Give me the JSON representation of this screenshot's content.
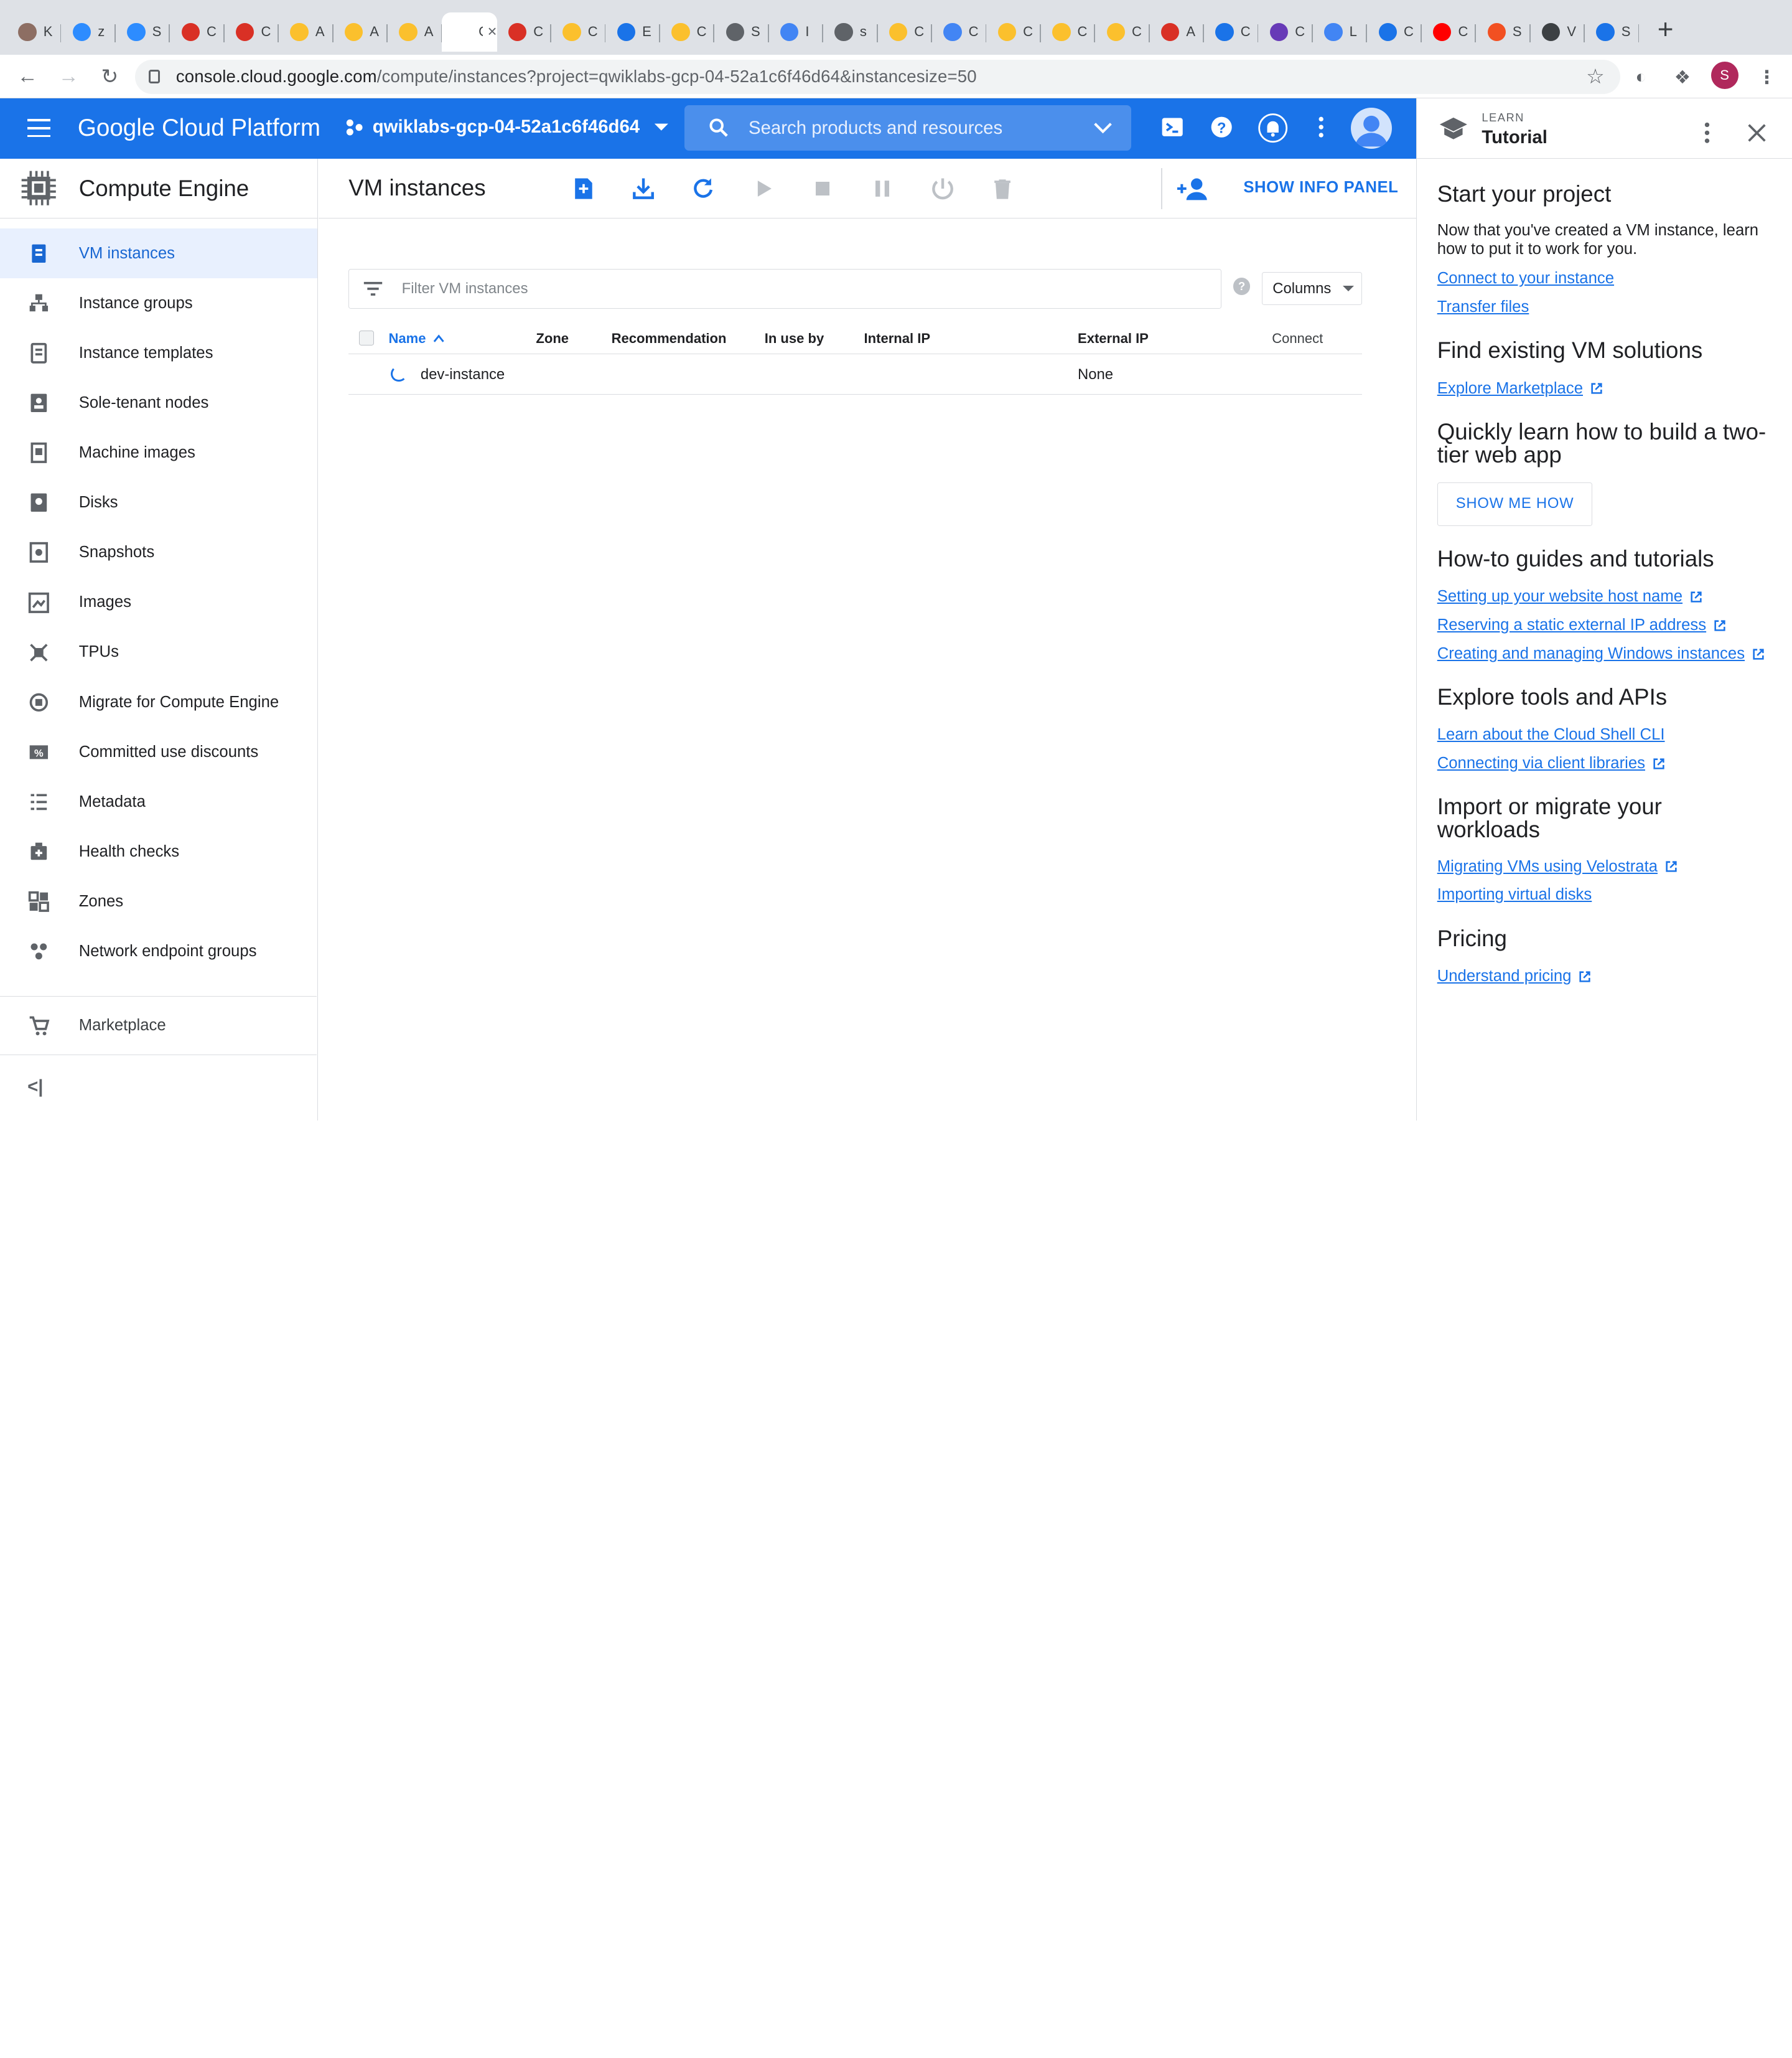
{
  "browser": {
    "tabs": [
      {
        "short": "K",
        "color": "#8d6e63"
      },
      {
        "short": "z",
        "color": "#2d8cff"
      },
      {
        "short": "S",
        "color": "#2d8cff"
      },
      {
        "short": "C",
        "color": "#d93025"
      },
      {
        "short": "C",
        "color": "#d93025"
      },
      {
        "short": "A",
        "color": "#fbc02d"
      },
      {
        "short": "A",
        "color": "#fbc02d"
      },
      {
        "short": "A",
        "color": "#fbc02d"
      },
      {
        "short": "G",
        "color": "#ffffff",
        "active": true
      },
      {
        "short": "C",
        "color": "#d93025"
      },
      {
        "short": "C",
        "color": "#fbc02d"
      },
      {
        "short": "E",
        "color": "#1a73e8"
      },
      {
        "short": "C",
        "color": "#fbc02d"
      },
      {
        "short": "S",
        "color": "#5f6368"
      },
      {
        "short": "I",
        "color": "#4285f4"
      },
      {
        "short": "s",
        "color": "#5f6368"
      },
      {
        "short": "C",
        "color": "#fbc02d"
      },
      {
        "short": "C",
        "color": "#4285f4"
      },
      {
        "short": "C",
        "color": "#fbc02d"
      },
      {
        "short": "C",
        "color": "#fbc02d"
      },
      {
        "short": "C",
        "color": "#fbc02d"
      },
      {
        "short": "A",
        "color": "#d93025"
      },
      {
        "short": "C",
        "color": "#1a73e8"
      },
      {
        "short": "C",
        "color": "#673ab7"
      },
      {
        "short": "L",
        "color": "#4285f4"
      },
      {
        "short": "C",
        "color": "#1a73e8"
      },
      {
        "short": "C",
        "color": "#ff0000"
      },
      {
        "short": "S",
        "color": "#f25022"
      },
      {
        "short": "V",
        "color": "#3c4043"
      },
      {
        "short": "S",
        "color": "#1a73e8"
      }
    ],
    "active_tab_title": "G",
    "url_host": "console.cloud.google.com",
    "url_path": "/compute/instances?project=qwiklabs-gcp-04-52a1c6f46d64&instancesize=50",
    "profile_initial": "S"
  },
  "gcp_header": {
    "brand": "Google Cloud Platform",
    "project": "qwiklabs-gcp-04-52a1c6f46d64",
    "search_placeholder": "Search products and resources"
  },
  "left_nav": {
    "title": "Compute Engine",
    "items": [
      {
        "label": "VM instances",
        "active": true
      },
      {
        "label": "Instance groups"
      },
      {
        "label": "Instance templates"
      },
      {
        "label": "Sole-tenant nodes"
      },
      {
        "label": "Machine images"
      },
      {
        "label": "Disks"
      },
      {
        "label": "Snapshots"
      },
      {
        "label": "Images"
      },
      {
        "label": "TPUs"
      },
      {
        "label": "Migrate for Compute Engine"
      },
      {
        "label": "Committed use discounts"
      },
      {
        "label": "Metadata"
      },
      {
        "label": "Health checks"
      },
      {
        "label": "Zones"
      },
      {
        "label": "Network endpoint groups"
      }
    ],
    "marketplace": "Marketplace",
    "collapse_label": "<|"
  },
  "main": {
    "title": "VM instances",
    "show_info_panel": "SHOW INFO PANEL",
    "filter_placeholder": "Filter VM instances",
    "columns_button": "Columns",
    "help_mark": "?",
    "table": {
      "headers": [
        "Name",
        "Zone",
        "Recommendation",
        "In use by",
        "Internal IP",
        "External IP",
        "Connect"
      ],
      "rows": [
        {
          "name": "dev-instance",
          "zone": "",
          "recommendation": "",
          "in_use_by": "",
          "internal_ip": "",
          "external_ip": "None",
          "connect": ""
        }
      ]
    }
  },
  "right_panel": {
    "eyebrow": "LEARN",
    "title": "Tutorial",
    "start_heading": "Start your project",
    "start_text": "Now that you've created a VM instance, learn how to put it to work for you.",
    "start_links": [
      "Connect to your instance",
      "Transfer files"
    ],
    "find_heading": "Find existing VM solutions",
    "find_link": "Explore Marketplace",
    "learn_heading": "Quickly learn how to build a two-tier web app",
    "show_me_how": "SHOW ME HOW",
    "guides_heading": "How-to guides and tutorials",
    "guides_links": [
      "Setting up your website host name",
      "Reserving a static external IP address",
      "Creating and managing Windows instances"
    ],
    "tools_heading": "Explore tools and APIs",
    "tools_links": [
      "Learn about the Cloud Shell CLI",
      "Connecting via client libraries"
    ],
    "import_heading": "Import or migrate your workloads",
    "import_links": [
      "Migrating VMs using Velostrata",
      "Importing virtual disks"
    ],
    "pricing_heading": "Pricing",
    "pricing_link": "Understand pricing"
  },
  "colors": {
    "gcp_blue": "#1a73e8",
    "active_nav_bg": "#e8f0fe"
  }
}
